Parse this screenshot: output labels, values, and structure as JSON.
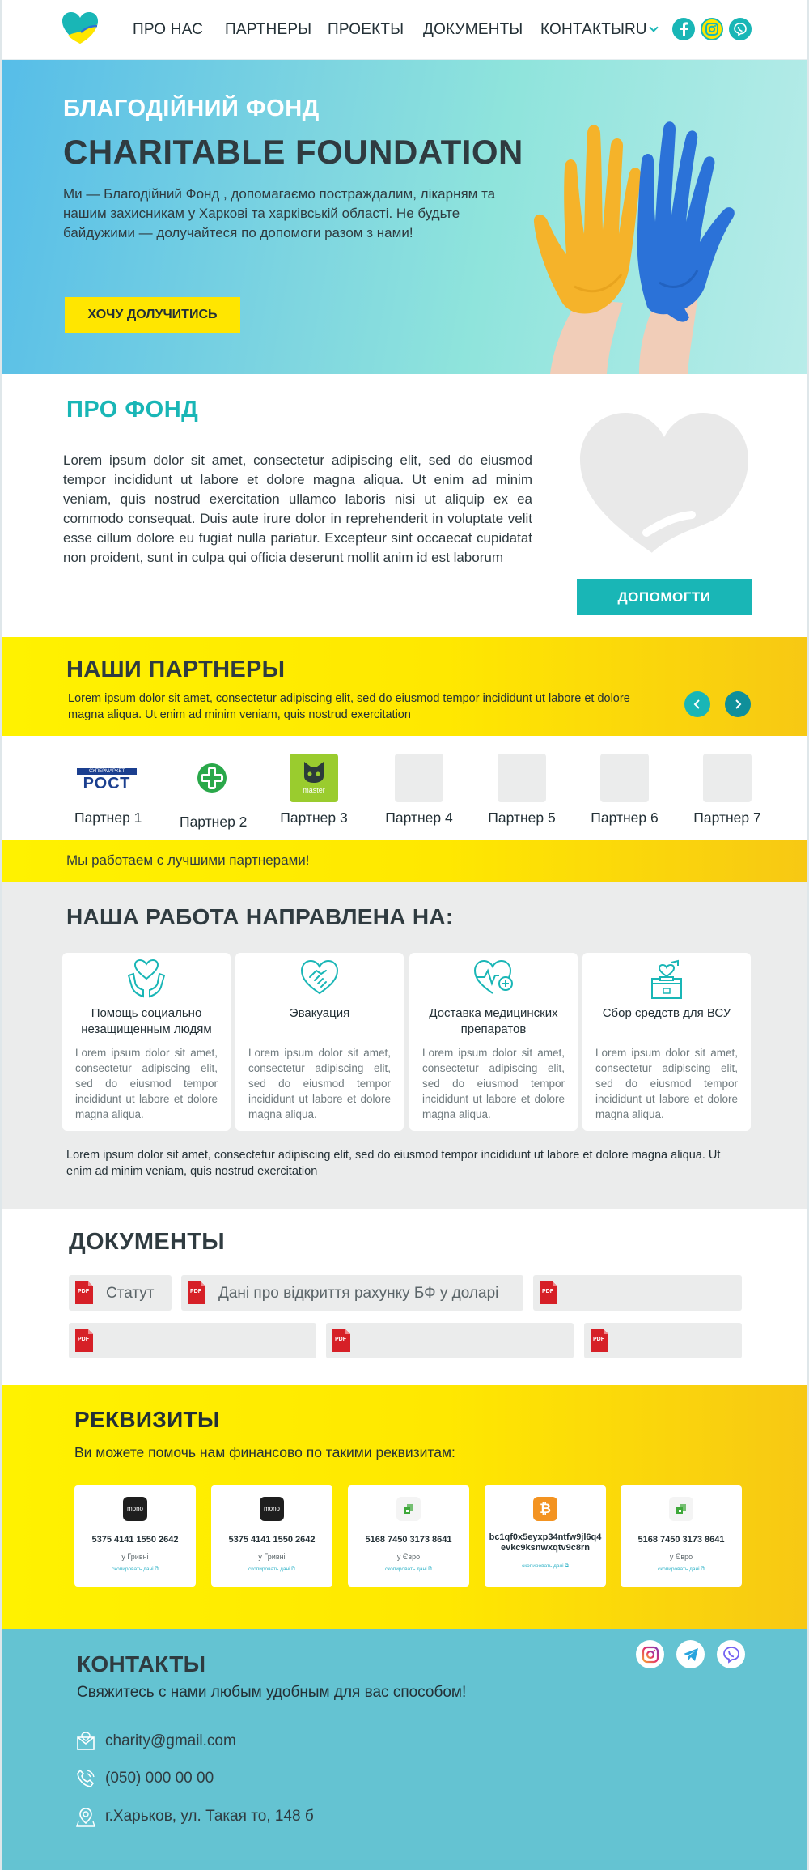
{
  "header": {
    "nav": [
      "ПРО НАС",
      "ПАРТНЕРЫ",
      "ПРОЕКТЫ",
      "ДОКУМЕНТЫ",
      "КОНТАКТЫ"
    ],
    "lang": "RU",
    "social_icons": [
      "facebook-icon",
      "instagram-icon",
      "viber-icon"
    ]
  },
  "hero": {
    "subtitle": "БЛАГОДІЙНИЙ ФОНД",
    "title": "CHARITABLE FOUNDATION",
    "text": "Ми — Благодійний Фонд , допомагаємо постраждалим, лікарням та нашим захисникам у Харкові та харківській області. Не будьте байдужими — долучайтеся по допомоги разом з нами!",
    "button": "ХОЧУ ДОЛУЧИТИСЬ"
  },
  "about": {
    "title": "ПРО ФОНД",
    "text": "Lorem ipsum dolor sit amet, consectetur adipiscing elit, sed do eiusmod tempor incididunt ut labore et dolore magna aliqua. Ut enim ad minim veniam, quis nostrud exercitation ullamco laboris nisi ut aliquip ex ea commodo consequat. Duis aute irure dolor in reprehenderit in voluptate velit esse cillum dolore eu fugiat nulla pariatur. Excepteur sint occaecat cupidatat non proident, sunt in culpa qui officia deserunt mollit anim id est laborum",
    "button": "ДОПОМОГТИ"
  },
  "partners": {
    "title": "НАШИ ПАРТНЕРЫ",
    "text": "Lorem ipsum dolor sit amet, consectetur adipiscing elit, sed do eiusmod tempor incididunt ut labore et dolore magna aliqua. Ut enim ad minim veniam, quis nostrud exercitation",
    "items": [
      "Партнер 1",
      "Партнер 2",
      "Партнер 3",
      "Партнер 4",
      "Партнер 5",
      "Партнер 6",
      "Партнер 7"
    ],
    "logo_texts": {
      "rost_small": "СУПЕРМАРКЕТ",
      "rost": "РОСТ",
      "master": "master"
    },
    "footer": "Мы работаем с лучшими партнерами!"
  },
  "work": {
    "title": "НАША РАБОТА НАПРАВЛЕНА НА:",
    "cards": [
      {
        "title": "Помощь социально незащищенным людям",
        "icon": "caring-hands-icon",
        "text": "Lorem ipsum dolor sit amet, consectetur adipiscing elit, sed do eiusmod tempor incididunt ut labore et dolore magna aliqua."
      },
      {
        "title": "Эвакуация",
        "icon": "handshake-heart-icon",
        "text": "Lorem ipsum dolor sit amet, consectetur adipiscing elit, sed do eiusmod tempor incididunt ut labore et dolore magna aliqua."
      },
      {
        "title": "Доставка медицинских препаратов",
        "icon": "medical-heart-icon",
        "text": "Lorem ipsum dolor sit amet, consectetur adipiscing elit, sed do eiusmod tempor incididunt ut labore et dolore magna aliqua."
      },
      {
        "title": "Сбор средств для ВСУ",
        "icon": "donation-box-icon",
        "text": "Lorem ipsum dolor sit amet, consectetur adipiscing elit, sed do eiusmod tempor incididunt ut labore et dolore magna aliqua."
      }
    ],
    "text": "Lorem ipsum dolor sit amet, consectetur adipiscing elit, sed do eiusmod tempor incididunt ut labore et dolore magna aliqua. Ut enim ad minim veniam, quis nostrud exercitation"
  },
  "documents": {
    "title": "ДОКУМЕНТЫ",
    "pdf_label": "PDF",
    "items": [
      "Статут",
      "Дані про відкриття рахунку БФ у  доларі",
      "",
      "",
      "",
      ""
    ]
  },
  "requisites": {
    "title": "РЕКВИЗИТЫ",
    "subtitle": "Ви можете помочь нам финансово по такими реквизитам:",
    "copy_label": "скопировать дані",
    "cards": [
      {
        "number": "5375 4141 1550 2642",
        "currency": "у Гривні",
        "icon": "monobank-icon",
        "brand": "mono"
      },
      {
        "number": "5375 4141 1550 2642",
        "currency": "у Гривні",
        "icon": "monobank-icon",
        "brand": "mono"
      },
      {
        "number": "5168 7450 3173 8641",
        "currency": "у Євро",
        "icon": "privatbank-icon",
        "brand": ""
      },
      {
        "number": "bc1qf0x5eyxp34ntfw9jl6q4evkc9ksnwxqtv9c8rn",
        "currency": "",
        "icon": "bitcoin-icon",
        "brand": ""
      },
      {
        "number": "5168 7450 3173 8641",
        "currency": "у Євро",
        "icon": "privatbank-icon",
        "brand": ""
      }
    ]
  },
  "contacts": {
    "title": "КОНТАКТЫ",
    "subtitle": "Свяжитесь с нами любым удобным для вас способом!",
    "email": "charity@gmail.com",
    "phone": "(050) 000 00 00",
    "address": "г.Харьков, ул. Такая то, 148 б",
    "social_icons": [
      "instagram-icon",
      "telegram-icon",
      "viber-icon"
    ]
  },
  "colors": {
    "teal": "#19b6b6",
    "yellow": "#ffe600",
    "blue": "#2b72d8",
    "contacts_bg": "#64c3d2",
    "gray_bg": "#ebecec"
  }
}
